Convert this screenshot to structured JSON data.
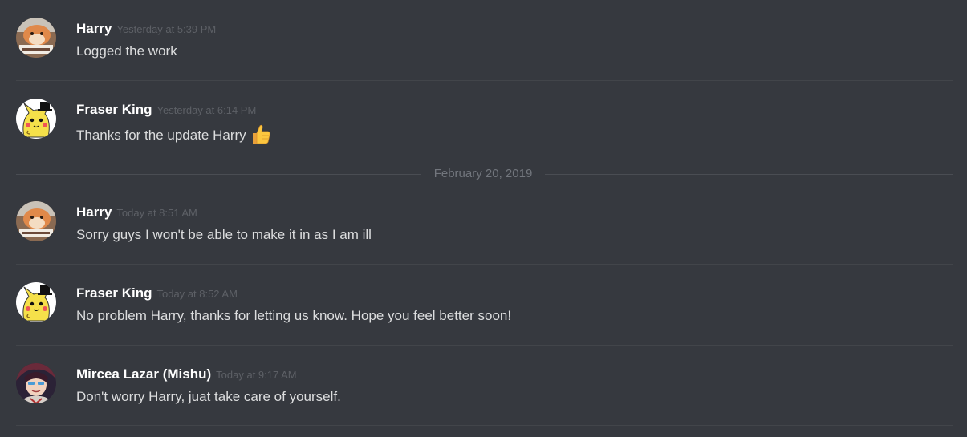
{
  "messages": [
    {
      "username": "Harry",
      "timestamp": "Yesterday at 5:39 PM",
      "content": "Logged the work",
      "avatar": "shiba-dog-avatar"
    },
    {
      "username": "Fraser King",
      "timestamp": "Yesterday at 6:14 PM",
      "content": "Thanks for the update Harry",
      "avatar": "pikachu-tophat-avatar",
      "emoji": "thumbs-up-icon"
    },
    {
      "username": "Harry",
      "timestamp": "Today at 8:51 AM",
      "content": "Sorry guys I won't be able to make it in as I am ill",
      "avatar": "shiba-dog-avatar"
    },
    {
      "username": "Fraser King",
      "timestamp": "Today at 8:52 AM",
      "content": "No problem Harry, thanks for letting us know. Hope you feel better soon!",
      "avatar": "pikachu-tophat-avatar"
    },
    {
      "username": "Mircea Lazar (Mishu)",
      "timestamp": "Today at 9:17 AM",
      "content": "Don't worry Harry, juat take care of yourself.",
      "avatar": "anime-character-avatar"
    }
  ],
  "date_divider": {
    "label": "February 20, 2019"
  },
  "colors": {
    "background": "#36393f",
    "username": "#ffffff",
    "timestamp": "#5d6066",
    "message_text": "#dcddde",
    "divider": "#42454a"
  }
}
